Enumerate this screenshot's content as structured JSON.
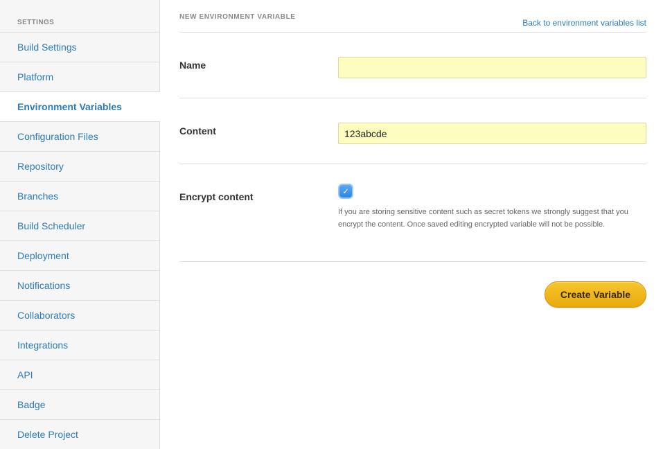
{
  "sidebar": {
    "heading": "SETTINGS",
    "items": [
      {
        "label": "Build Settings"
      },
      {
        "label": "Platform"
      },
      {
        "label": "Environment Variables"
      },
      {
        "label": "Configuration Files"
      },
      {
        "label": "Repository"
      },
      {
        "label": "Branches"
      },
      {
        "label": "Build Scheduler"
      },
      {
        "label": "Deployment"
      },
      {
        "label": "Notifications"
      },
      {
        "label": "Collaborators"
      },
      {
        "label": "Integrations"
      },
      {
        "label": "API"
      },
      {
        "label": "Badge"
      },
      {
        "label": "Delete Project"
      }
    ],
    "active_index": 2
  },
  "main": {
    "section_title": "NEW ENVIRONMENT VARIABLE",
    "back_link": "Back to environment variables list",
    "form": {
      "name": {
        "label": "Name",
        "value": ""
      },
      "content": {
        "label": "Content",
        "value": "123abcde"
      },
      "encrypt": {
        "label": "Encrypt content",
        "checked": true,
        "check_glyph": "✓",
        "help": "If you are storing sensitive content such as secret tokens we strongly suggest that you encrypt the content. Once saved editing encrypted variable will not be possible."
      },
      "submit_label": "Create Variable"
    }
  },
  "colors": {
    "link": "#2b7bb9",
    "input_bg": "#fdfdc0",
    "button": "#f2b81c"
  }
}
